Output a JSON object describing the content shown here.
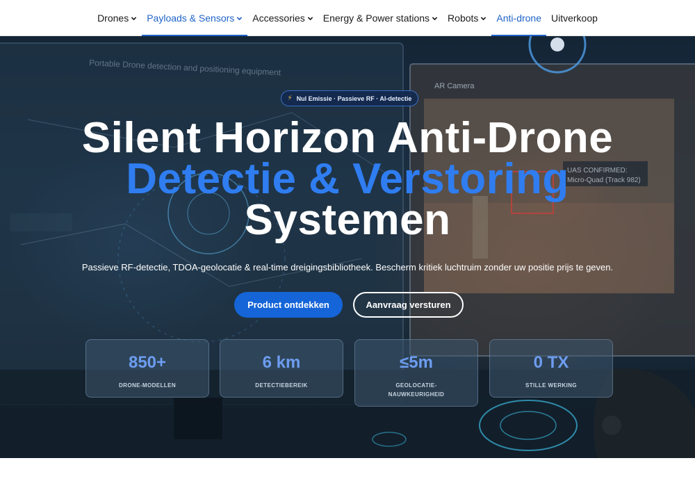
{
  "nav": {
    "items": [
      {
        "label": "Drones",
        "dropdown": true,
        "active": false
      },
      {
        "label": "Payloads & Sensors",
        "dropdown": true,
        "active": true
      },
      {
        "label": "Accessories",
        "dropdown": true,
        "active": false
      },
      {
        "label": "Energy & Power stations",
        "dropdown": true,
        "active": false
      },
      {
        "label": "Robots",
        "dropdown": true,
        "active": false
      },
      {
        "label": "Anti-drone",
        "dropdown": false,
        "active": true
      },
      {
        "label": "Uitverkoop",
        "dropdown": false,
        "active": false
      }
    ]
  },
  "hero": {
    "badge": "Nul Emissie · Passieve RF · AI-detectie",
    "title_line1": "Silent Horizon Anti-Drone",
    "title_line2": "Detectie & Verstoring",
    "title_line3": "Systemen",
    "subtitle": "Passieve RF-detectie, TDOA-geolocatie & real-time dreigingsbibliotheek. Bescherm kritiek luchtruim zonder uw positie prijs te geven.",
    "primary_button": "Product ontdekken",
    "secondary_button": "Aanvraag versturen",
    "stats": [
      {
        "value": "850+",
        "label": "DRONE-MODELLEN"
      },
      {
        "value": "6 km",
        "label": "DETECTIEBEREIK"
      },
      {
        "value": "≤5m",
        "label": "GEOLOCATIE-NAUWKEURIGHEID"
      },
      {
        "value": "0 TX",
        "label": "STILLE WERKING"
      }
    ]
  },
  "background_text": {
    "screen_left_title": "Portable Drone detection and positioning equipment",
    "screen_right_title": "AR Camera",
    "alert_line1": "UAS CONFIRMED:",
    "alert_line2": "Micro-Quad (Track 982)"
  },
  "colors": {
    "accent": "#1f63c6",
    "title_highlight": "#2f7df0",
    "primary_button": "#1565d8",
    "stat_value": "#6d9df0"
  }
}
